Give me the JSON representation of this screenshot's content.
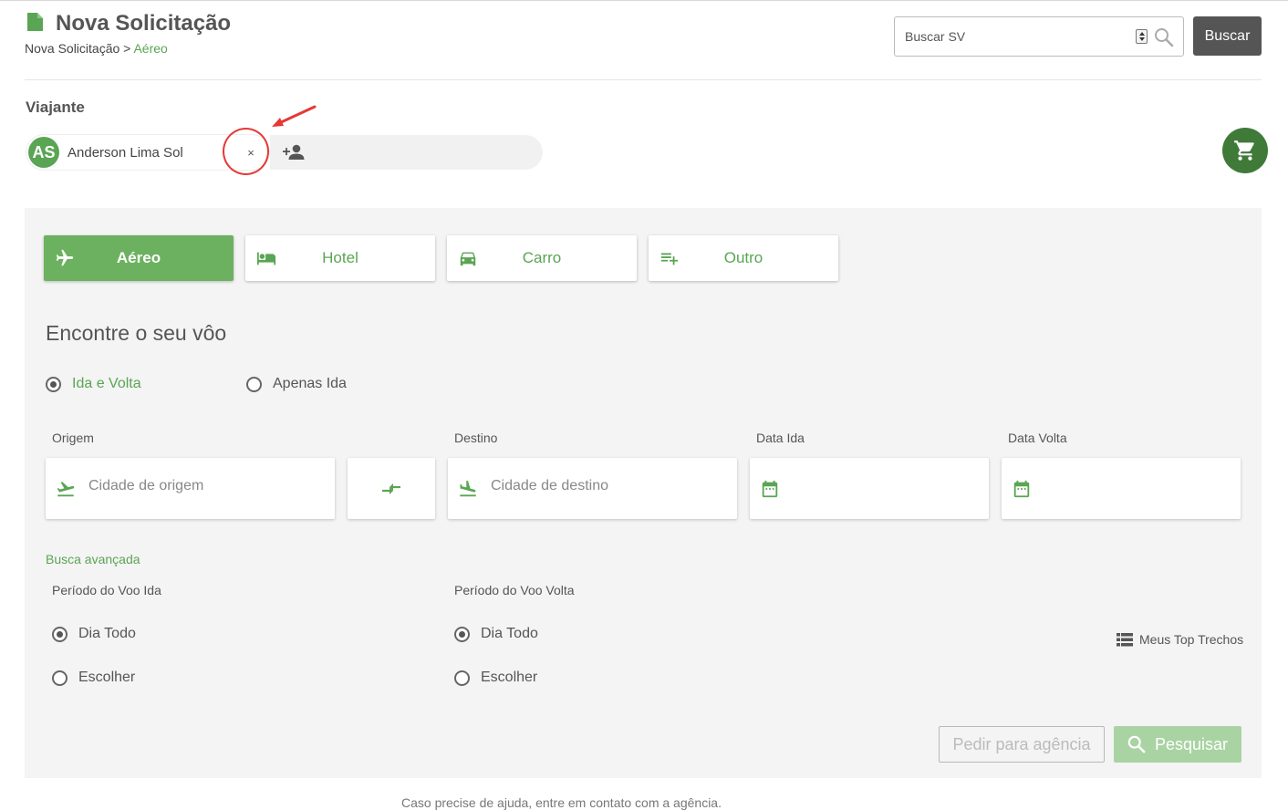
{
  "header": {
    "title": "Nova Solicitação",
    "breadcrumb": {
      "root": "Nova Solicitação",
      "separator": " > ",
      "current": "Aéreo"
    },
    "search": {
      "placeholder": "Buscar SV",
      "button_label": "Buscar"
    }
  },
  "traveler": {
    "section_label": "Viajante",
    "chip": {
      "initials": "AS",
      "name": "Anderson Lima Sol",
      "remove_label": "×"
    }
  },
  "tabs": [
    {
      "label": "Aéreo",
      "icon": "airplane-icon",
      "active": true
    },
    {
      "label": "Hotel",
      "icon": "bed-icon",
      "active": false
    },
    {
      "label": "Carro",
      "icon": "car-icon",
      "active": false
    },
    {
      "label": "Outro",
      "icon": "playlist-add-icon",
      "active": false
    }
  ],
  "flight_search": {
    "title": "Encontre o seu vôo",
    "trip_type": [
      {
        "label": "Ida e Volta",
        "selected": true
      },
      {
        "label": "Apenas Ida",
        "selected": false
      }
    ],
    "origin": {
      "label": "Origem",
      "placeholder": "Cidade de origem"
    },
    "destination": {
      "label": "Destino",
      "placeholder": "Cidade de destino"
    },
    "date_out": {
      "label": "Data Ida",
      "value": ""
    },
    "date_back": {
      "label": "Data Volta",
      "value": ""
    },
    "advanced_link": "Busca avançada",
    "period_out": {
      "label": "Período do Voo Ida",
      "options": [
        "Dia Todo",
        "Escolher"
      ],
      "selected": "Dia Todo"
    },
    "period_back": {
      "label": "Período do Voo Volta",
      "options": [
        "Dia Todo",
        "Escolher"
      ],
      "selected": "Dia Todo"
    },
    "top_trechos": "Meus Top Trechos",
    "btn_agencia": "Pedir para agência",
    "btn_pesquisar": "Pesquisar"
  },
  "colors": {
    "accent": "#5aa553",
    "accent_dark": "#3f7a39",
    "annotation": "#e53935"
  },
  "footer": {
    "text": "Caso precise de ajuda, entre em contato com a agência."
  }
}
